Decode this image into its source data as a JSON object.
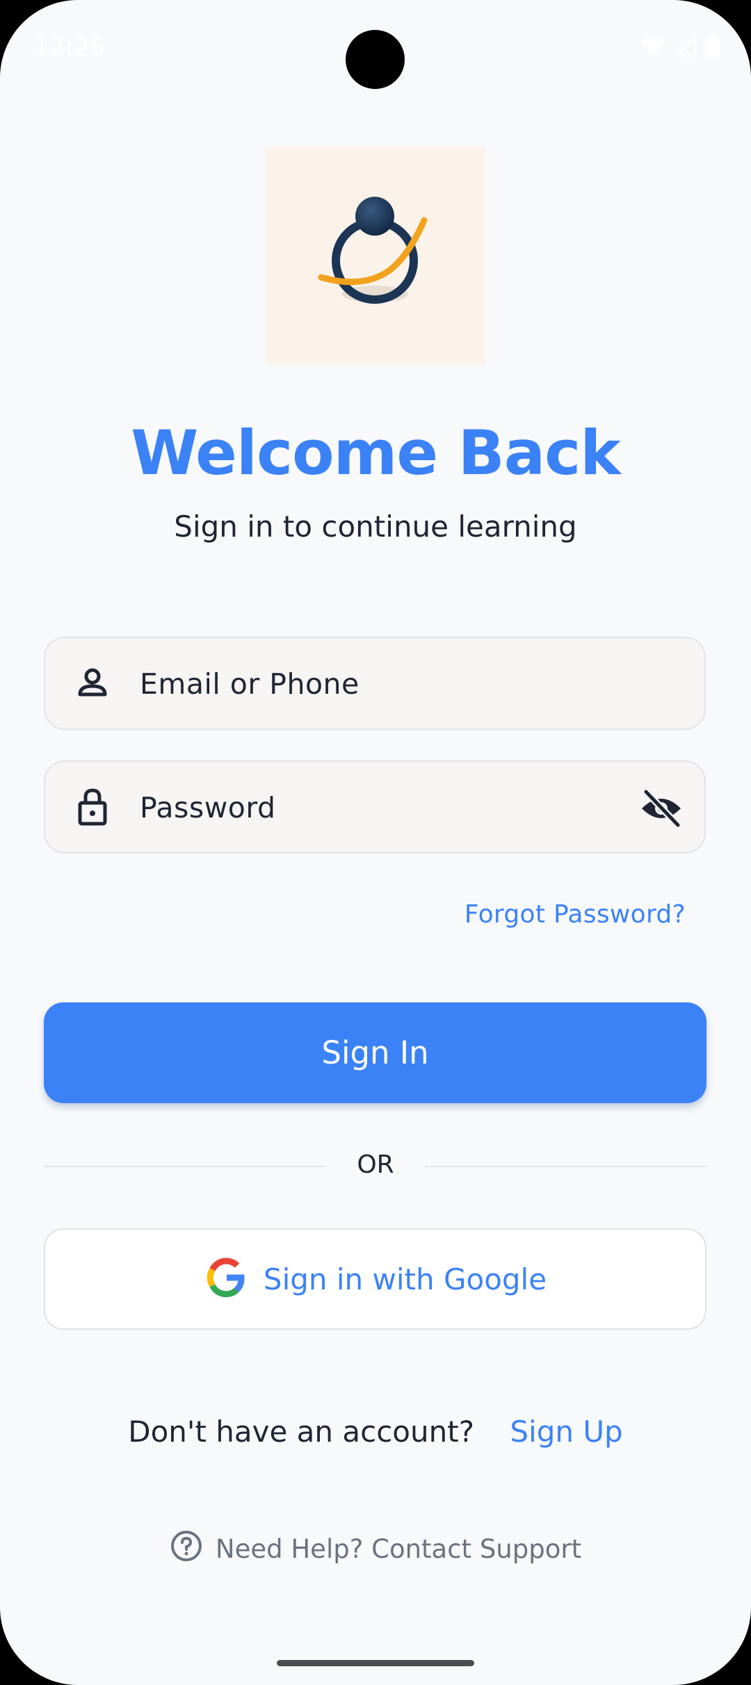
{
  "status_bar": {
    "time": "12:25",
    "icons": [
      "wifi-icon",
      "cellular-icon",
      "battery-icon"
    ]
  },
  "logo": {
    "icon": "app-logo"
  },
  "header": {
    "title": "Welcome Back",
    "subtitle": "Sign in to continue learning"
  },
  "form": {
    "email_placeholder": "Email or Phone",
    "password_placeholder": "Password",
    "forgot_label": "Forgot Password?",
    "signin_label": "Sign In"
  },
  "divider": {
    "label": "OR"
  },
  "google": {
    "label": "Sign in with Google"
  },
  "account": {
    "prompt": "Don't have an account?",
    "signup_label": "Sign Up"
  },
  "help": {
    "label": "Need Help? Contact Support"
  },
  "colors": {
    "accent": "#3b82f6",
    "background": "#f8f9fb",
    "text": "#1f2533",
    "muted": "#6b7280"
  }
}
